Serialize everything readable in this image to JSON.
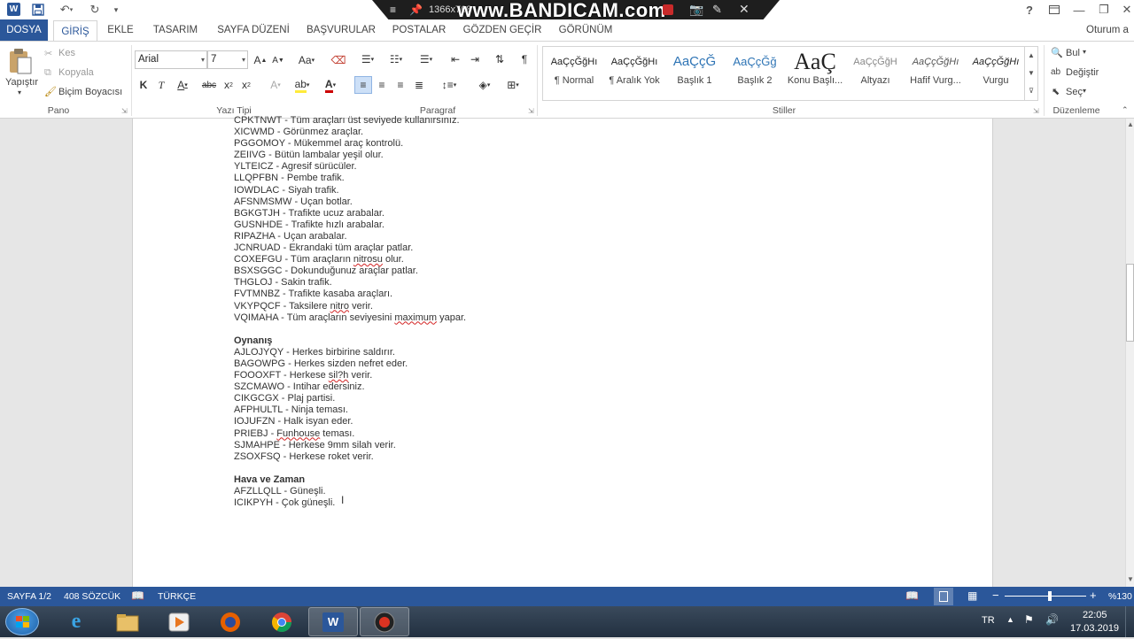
{
  "title_bar": {
    "recorder_resolution": "1366x768",
    "watermark": "www.BANDICAM.com",
    "help": "?",
    "account": "Oturum a"
  },
  "tabs": [
    "DOSYA",
    "GİRİŞ",
    "EKLE",
    "TASARIM",
    "SAYFA DÜZENİ",
    "BAŞVURULAR",
    "POSTALAR",
    "GÖZDEN GEÇİR",
    "GÖRÜNÜM"
  ],
  "ribbon": {
    "clipboard": {
      "paste": "Yapıştır",
      "cut": "Kes",
      "copy": "Kopyala",
      "format_painter": "Biçim Boyacısı",
      "label": "Pano"
    },
    "font": {
      "name": "Arial",
      "size": "7",
      "label": "Yazı Tipi",
      "change_case": "Aa"
    },
    "paragraph": {
      "label": "Paragraf"
    },
    "styles": {
      "label": "Stiller",
      "items": [
        {
          "preview": "AaÇçĞğHı",
          "name": "¶ Normal"
        },
        {
          "preview": "AaÇçĞğHı",
          "name": "¶ Aralık Yok"
        },
        {
          "preview": "AaÇçĞ",
          "name": "Başlık 1"
        },
        {
          "preview": "AaÇçĞğ",
          "name": "Başlık 2"
        },
        {
          "preview": "AaÇ",
          "name": "Konu Başlı..."
        },
        {
          "preview": "AaÇçĞğH",
          "name": "Altyazı"
        },
        {
          "preview": "AaÇçĞğHı",
          "name": "Hafif Vurg..."
        },
        {
          "preview": "AaÇçĞğHı",
          "name": "Vurgu"
        }
      ]
    },
    "editing": {
      "find": "Bul",
      "replace": "Değiştir",
      "select": "Seç",
      "label": "Düzenleme"
    }
  },
  "document": {
    "lines": [
      {
        "text": "CPKTNWT - Tüm araçları üst seviyede kullanırsınız."
      },
      {
        "text": "XICWMD - Görünmez araçlar."
      },
      {
        "text": "PGGOMOY - Mükemmel araç kontrolü."
      },
      {
        "text": "ZEIIVG - Bütün lambalar yeşil olur."
      },
      {
        "text": "YLTEICZ - Agresif sürücüler."
      },
      {
        "text": "LLQPFBN - Pembe trafik."
      },
      {
        "text": "IOWDLAC - Siyah trafik."
      },
      {
        "text": "AFSNMSMW - Uçan botlar."
      },
      {
        "text": "BGKGTJH - Trafikte ucuz arabalar."
      },
      {
        "text": "GUSNHDE - Trafikte hızlı arabalar."
      },
      {
        "text": "RIPAZHA - Uçan arabalar."
      },
      {
        "text": "JCNRUAD - Ekrandaki tüm araçlar patlar."
      },
      {
        "pre": "COXEFGU - Tüm araçların ",
        "sq": "nitrosu",
        "post": " olur."
      },
      {
        "text": "BSXSGGC - Dokunduğunuz araçlar patlar."
      },
      {
        "text": "THGLOJ - Sakin trafik."
      },
      {
        "text": "FVTMNBZ - Trafikte kasaba araçları."
      },
      {
        "pre": "VKYPQCF - Taksilere ",
        "sq": "nitro",
        "post": " verir."
      },
      {
        "pre": "VQIMAHA - Tüm araçların seviyesini ",
        "sq": "maximum",
        "post": " yapar."
      },
      {
        "text": ""
      },
      {
        "text": "Oynanış",
        "head": true
      },
      {
        "text": "AJLOJYQY - Herkes birbirine saldırır."
      },
      {
        "text": "BAGOWPG - Herkes sizden nefret eder."
      },
      {
        "pre": "FOOOXFT - Herkese ",
        "sq": "sil?h",
        "post": " verir."
      },
      {
        "text": "SZCMAWO - Intihar edersiniz."
      },
      {
        "text": "CIKGCGX - Plaj partisi."
      },
      {
        "text": "AFPHULTL - Ninja teması."
      },
      {
        "text": "IOJUFZN - Halk isyan eder."
      },
      {
        "pre": "PRIEBJ - ",
        "sq": "Funhouse",
        "post": " teması."
      },
      {
        "text": "SJMAHPE - Herkese 9mm silah verir."
      },
      {
        "text": "ZSOXFSQ - Herkese roket verir."
      },
      {
        "text": ""
      },
      {
        "text": "Hava ve Zaman",
        "head": true
      },
      {
        "text": "AFZLLQLL - Güneşli."
      },
      {
        "text": "ICIKPYH - Çok güneşli."
      }
    ]
  },
  "status": {
    "page": "SAYFA 1/2",
    "words": "408 SÖZCÜK",
    "language": "TÜRKÇE",
    "zoom": "%130",
    "zoom_fraction": 0.55
  },
  "taskbar": {
    "language": "TR",
    "time": "22:05",
    "date": "17.03.2019"
  },
  "colors": {
    "accent": "#2b579a",
    "squiggle": "#d22222"
  }
}
